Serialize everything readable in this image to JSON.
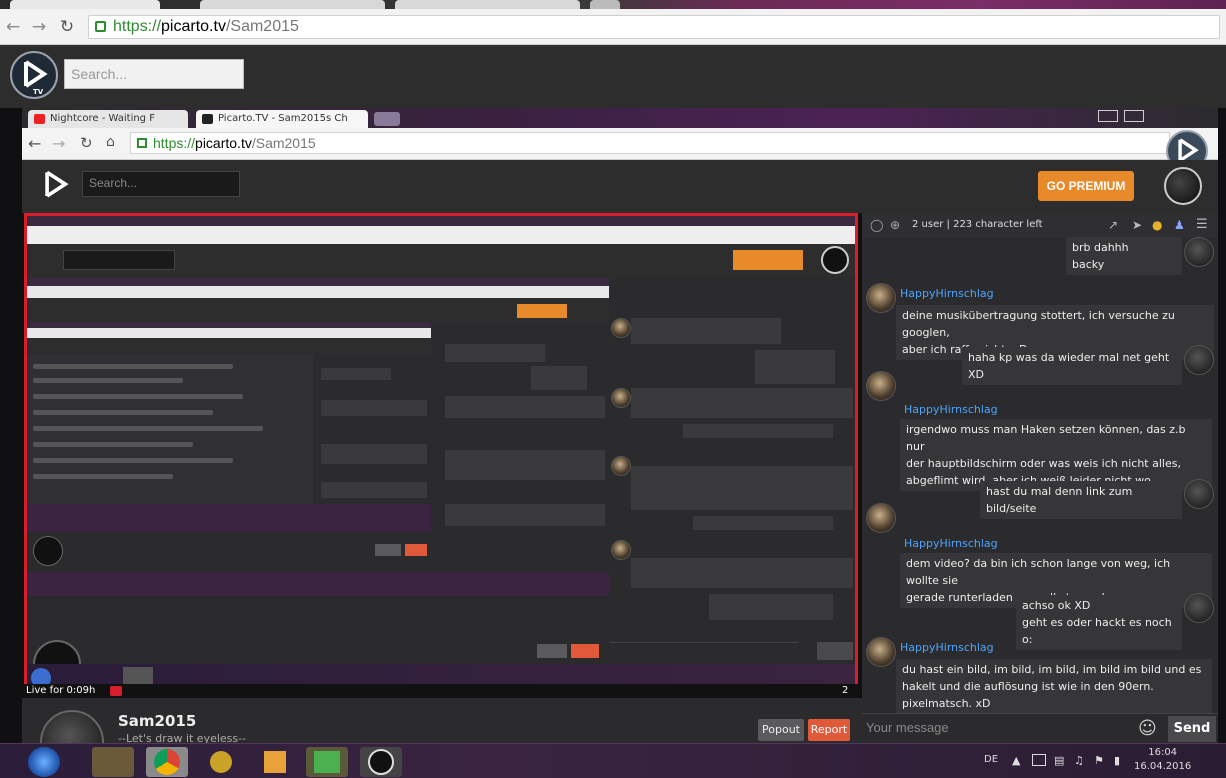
{
  "browser": {
    "url_scheme": "https://",
    "url_host": "picarto.tv",
    "url_path": "/Sam2015"
  },
  "header": {
    "logo_text": "TV",
    "search_placeholder": "Search..."
  },
  "inner": {
    "tabs": [
      {
        "label": "Nightcore - Waiting F"
      },
      {
        "label": "Picarto.TV - Sam2015s Ch"
      }
    ],
    "url_scheme": "https://",
    "url_host": "picarto.tv",
    "url_path": "/Sam2015",
    "search_placeholder": "Search...",
    "premium_label": "GO PREMIUM",
    "live_text": "Live for 0:09h",
    "video_counter": "2"
  },
  "chat": {
    "status": "2 user | 223 character left",
    "messages": [
      {
        "side": "right",
        "text": "brb dahhh"
      },
      {
        "side": "right",
        "text": "backy"
      },
      {
        "side": "left",
        "name": "HappyHirnschlag",
        "lines": [
          "deine musikübertragung stottert, ich versuche zu googlen,",
          "aber ich raffs nicht, xD"
        ]
      },
      {
        "side": "right",
        "text": "haha kp was da wieder mal net geht XD"
      },
      {
        "side": "left",
        "name": "HappyHirnschlag",
        "lines": [
          "irgendwo muss man Haken setzen können, das z.b nur",
          "der hauptbildschirm oder was weis ich nicht alles,",
          "abgeflimt wird, aber ich weiß leider nicht wo"
        ]
      },
      {
        "side": "right",
        "text": "hast du mal denn link zum bild/seite"
      },
      {
        "side": "left",
        "name": "HappyHirnschlag",
        "lines": [
          "dem video? da bin ich schon lange von weg, ich wollte sie",
          "gerade runterladen um selbst zu schauen. o.o"
        ]
      },
      {
        "side": "right",
        "text": "achso ok XD"
      },
      {
        "side": "right",
        "text": "geht es oder hackt es noch o:"
      },
      {
        "side": "left",
        "name": "HappyHirnschlag",
        "lines": [
          "du hast ein bild, im bild, im bild, im bild im bild und es",
          "hakelt und die auflösung ist wie in den 90ern.",
          "pixelmatsch. xD"
        ]
      }
    ],
    "input_placeholder": "Your message",
    "send_label": "Send"
  },
  "streamer": {
    "name": "Sam2015",
    "tagline": "--Let's draw it eyeless--",
    "popout_label": "Popout",
    "report_label": "Report"
  },
  "taskbar": {
    "lang": "DE",
    "time": "16:04",
    "date": "16.04.2016"
  },
  "colors": {
    "accent_orange": "#e8892a",
    "report_red": "#e05a3a",
    "username_blue": "#4da3ff",
    "frame_red": "#d71e2a"
  }
}
